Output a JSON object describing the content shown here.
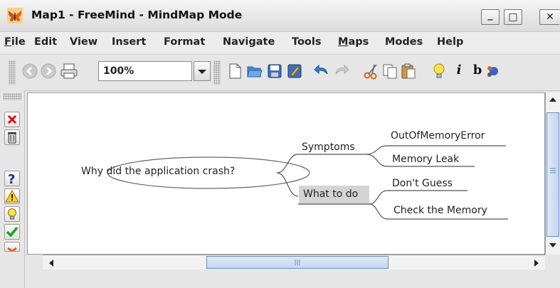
{
  "window": {
    "title": "Map1 - FreeMind - MindMap Mode",
    "buttons": {
      "minimize_glyph": "_",
      "maximize_glyph": "□",
      "close_glyph": "✕"
    }
  },
  "menu": {
    "items": [
      {
        "label": "File",
        "underline": "F",
        "rest": "ile"
      },
      {
        "label": "Edit"
      },
      {
        "label": "View"
      },
      {
        "label": "Insert"
      },
      {
        "label": "Format"
      },
      {
        "label": "Navigate"
      },
      {
        "label": "Tools"
      },
      {
        "label": "Maps",
        "underline": "M",
        "rest": "aps"
      },
      {
        "label": "Modes"
      },
      {
        "label": "Help"
      }
    ]
  },
  "toolbar": {
    "zoom_value": "100%",
    "italic_label": "i",
    "bold_label": "b",
    "icons": [
      "back-icon",
      "forward-icon",
      "print-icon",
      "new-map-icon",
      "open-icon",
      "save-icon",
      "edit-icon",
      "undo-icon",
      "redo-icon",
      "cut-icon",
      "copy-icon",
      "paste-icon",
      "idea-icon",
      "italic-icon",
      "bold-icon",
      "cloud-icon"
    ]
  },
  "icon_panel": {
    "icons": [
      "remove-last-icon",
      "remove-all-icons",
      "question-icon",
      "warning-icon",
      "idea-icon",
      "checkmark-icon",
      "cross-icon"
    ]
  },
  "mindmap": {
    "root": "Why did the application crash?",
    "branches": [
      {
        "label": "Symptoms",
        "children": [
          "OutOfMemoryError",
          "Memory Leak"
        ]
      },
      {
        "label": "What to do",
        "highlighted": true,
        "children": [
          "Don't Guess",
          "Check the Memory"
        ]
      }
    ]
  },
  "colors": {
    "accent_blue": "#4a78c2",
    "highlight_gray": "#d4d4d4",
    "edge_color": "#555555"
  }
}
